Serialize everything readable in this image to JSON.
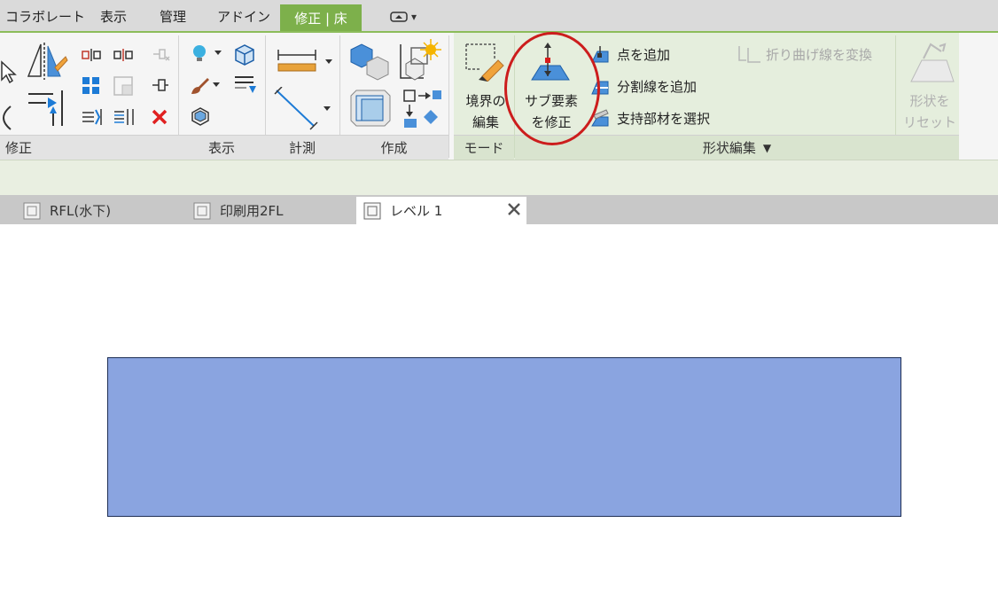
{
  "menu": {
    "tabs": [
      "コラボレート",
      "表示",
      "管理",
      "アドイン"
    ],
    "active_tab": "修正 | 床",
    "context_button_icon": "contextual-tab-dropdown-icon"
  },
  "ribbon": {
    "panels": {
      "modify": "修正",
      "view": "表示",
      "measure": "計測",
      "create": "作成",
      "mode": "モード",
      "shape_edit": "形状編集"
    },
    "mode": {
      "edit_boundary": [
        "境界の",
        "編集"
      ]
    },
    "shape_edit": {
      "modify_sub_elements": [
        "サブ要素",
        "を修正"
      ],
      "add_point": "点を追加",
      "add_split_line": "分割線を追加",
      "pick_supports": "支持部材を選択",
      "draw_splitting_line": "折り曲げ線を変換",
      "reset_shape": [
        "形状を",
        "リセット"
      ]
    }
  },
  "view_tabs": [
    {
      "label": "RFL(水下)",
      "active": false
    },
    {
      "label": "印刷用2FL",
      "active": false
    },
    {
      "label": "レベル 1",
      "active": true
    }
  ],
  "colors": {
    "accent_green": "#7db04b",
    "floor_fill": "#8aa4e0",
    "highlight_ring": "#cc1d1d"
  }
}
